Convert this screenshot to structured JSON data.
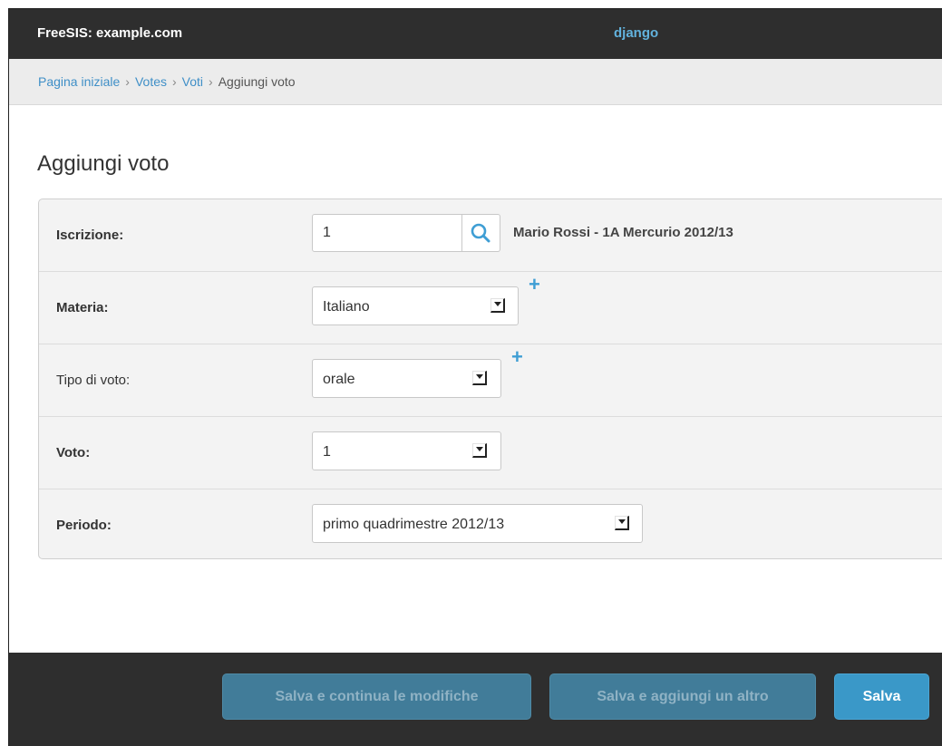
{
  "header": {
    "brand": "FreeSIS: example.com",
    "user": "django"
  },
  "breadcrumbs": {
    "home": "Pagina iniziale",
    "app": "Votes",
    "model": "Voti",
    "current": "Aggiungi voto",
    "separator": "›"
  },
  "page": {
    "title": "Aggiungi voto"
  },
  "form": {
    "iscrizione": {
      "label": "Iscrizione:",
      "value": "1",
      "related": "Mario Rossi - 1A Mercurio 2012/13",
      "lookup_icon": "search-icon"
    },
    "materia": {
      "label": "Materia:",
      "selected": "Italiano",
      "add": "+"
    },
    "tipo": {
      "label": "Tipo di voto:",
      "selected": "orale",
      "add": "+"
    },
    "voto": {
      "label": "Voto:",
      "selected": "1"
    },
    "periodo": {
      "label": "Periodo:",
      "selected": "primo quadrimestre 2012/13"
    }
  },
  "submit": {
    "continue_label": "Salva e continua le modifiche",
    "add_another_label": "Salva e aggiungi un altro",
    "save_label": "Salva"
  },
  "colors": {
    "header_bg": "#2e2e2e",
    "link": "#3f8fc7",
    "primary_button": "#3a98c8",
    "secondary_button": "#417c99"
  }
}
